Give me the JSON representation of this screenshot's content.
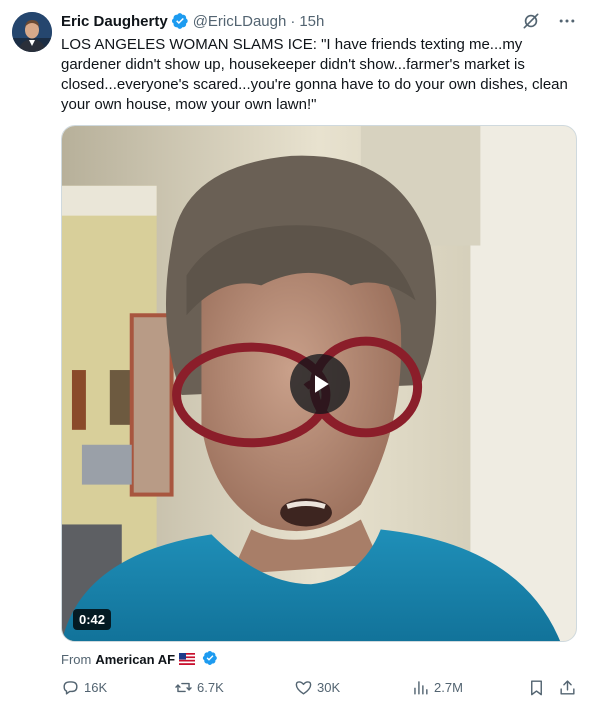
{
  "tweet": {
    "author_name": "Eric Daugherty",
    "handle": "@EricLDaugh",
    "separator": "·",
    "time": "15h",
    "text": "LOS ANGELES WOMAN SLAMS ICE: \"I have friends texting me...my gardener didn't show up, housekeeper didn't show...farmer's market is closed...everyone's scared...you're gonna have to do your own dishes, clean your own house, mow your own lawn!\"",
    "video_duration": "0:42",
    "from_label": "From",
    "from_source": "American AF"
  },
  "stats": {
    "replies": "16K",
    "reposts": "6.7K",
    "likes": "30K",
    "views": "2.7M"
  },
  "icons": {
    "verified": "verified-badge-icon",
    "grok": "grok-icon",
    "more": "more-icon",
    "play": "play-icon",
    "flag": "us-flag-icon",
    "reply": "reply-icon",
    "repost": "repost-icon",
    "like": "heart-icon",
    "views": "views-icon",
    "bookmark": "bookmark-icon",
    "share": "share-icon"
  },
  "colors": {
    "accent": "#1d9bf0",
    "text": "#0f1419",
    "muted": "#536471"
  }
}
